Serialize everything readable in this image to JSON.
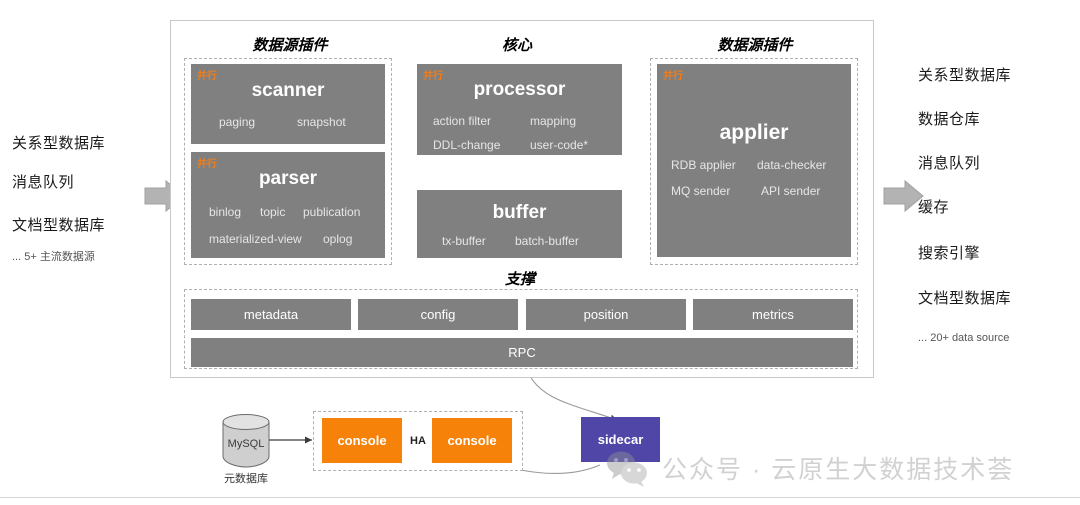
{
  "left_sources": {
    "items": [
      "关系型数据库",
      "消息队列",
      "文档型数据库"
    ],
    "note": "... 5+ 主流数据源"
  },
  "right_targets": {
    "items": [
      "关系型数据库",
      "数据仓库",
      "消息队列",
      "缓存",
      "搜索引擎",
      "文档型数据库"
    ],
    "note": "... 20+ data source"
  },
  "sections": {
    "source_plugin_left": "数据源插件",
    "core": "核心",
    "source_plugin_right": "数据源插件",
    "support": "支撑"
  },
  "labels": {
    "parallel": "并行"
  },
  "modules": {
    "scanner": {
      "title": "scanner",
      "parallel": "并行",
      "features": [
        "paging",
        "snapshot"
      ]
    },
    "parser": {
      "title": "parser",
      "parallel": "并行",
      "features_row1": [
        "binlog",
        "topic",
        "publication"
      ],
      "features_row2": [
        "materialized-view",
        "oplog"
      ]
    },
    "processor": {
      "title": "processor",
      "parallel": "并行",
      "features_row1": [
        "action filter",
        "mapping"
      ],
      "features_row2": [
        "DDL-change",
        "user-code*"
      ]
    },
    "buffer": {
      "title": "buffer",
      "features": [
        "tx-buffer",
        "batch-buffer"
      ]
    },
    "applier": {
      "title": "applier",
      "parallel": "并行",
      "features_row1": [
        "RDB applier",
        "data-checker"
      ],
      "features_row2": [
        "MQ sender",
        "API sender"
      ]
    }
  },
  "support": {
    "tiles": [
      "metadata",
      "config",
      "position",
      "metrics"
    ],
    "rpc": "RPC"
  },
  "bottom": {
    "mysql": "MySQL",
    "mysql_label": "元数据库",
    "console_left": "console",
    "console_right": "console",
    "ha": "HA",
    "sidecar": "sidecar"
  },
  "watermark": {
    "text": "公众号 · 云原生大数据技术荟"
  },
  "colors": {
    "module_gray": "#808080",
    "orange": "#f7820a",
    "parallel_orange": "#f07d18",
    "purple": "#4f46a8",
    "frame": "#c9c9c9",
    "dashed": "#b0b0b0"
  }
}
